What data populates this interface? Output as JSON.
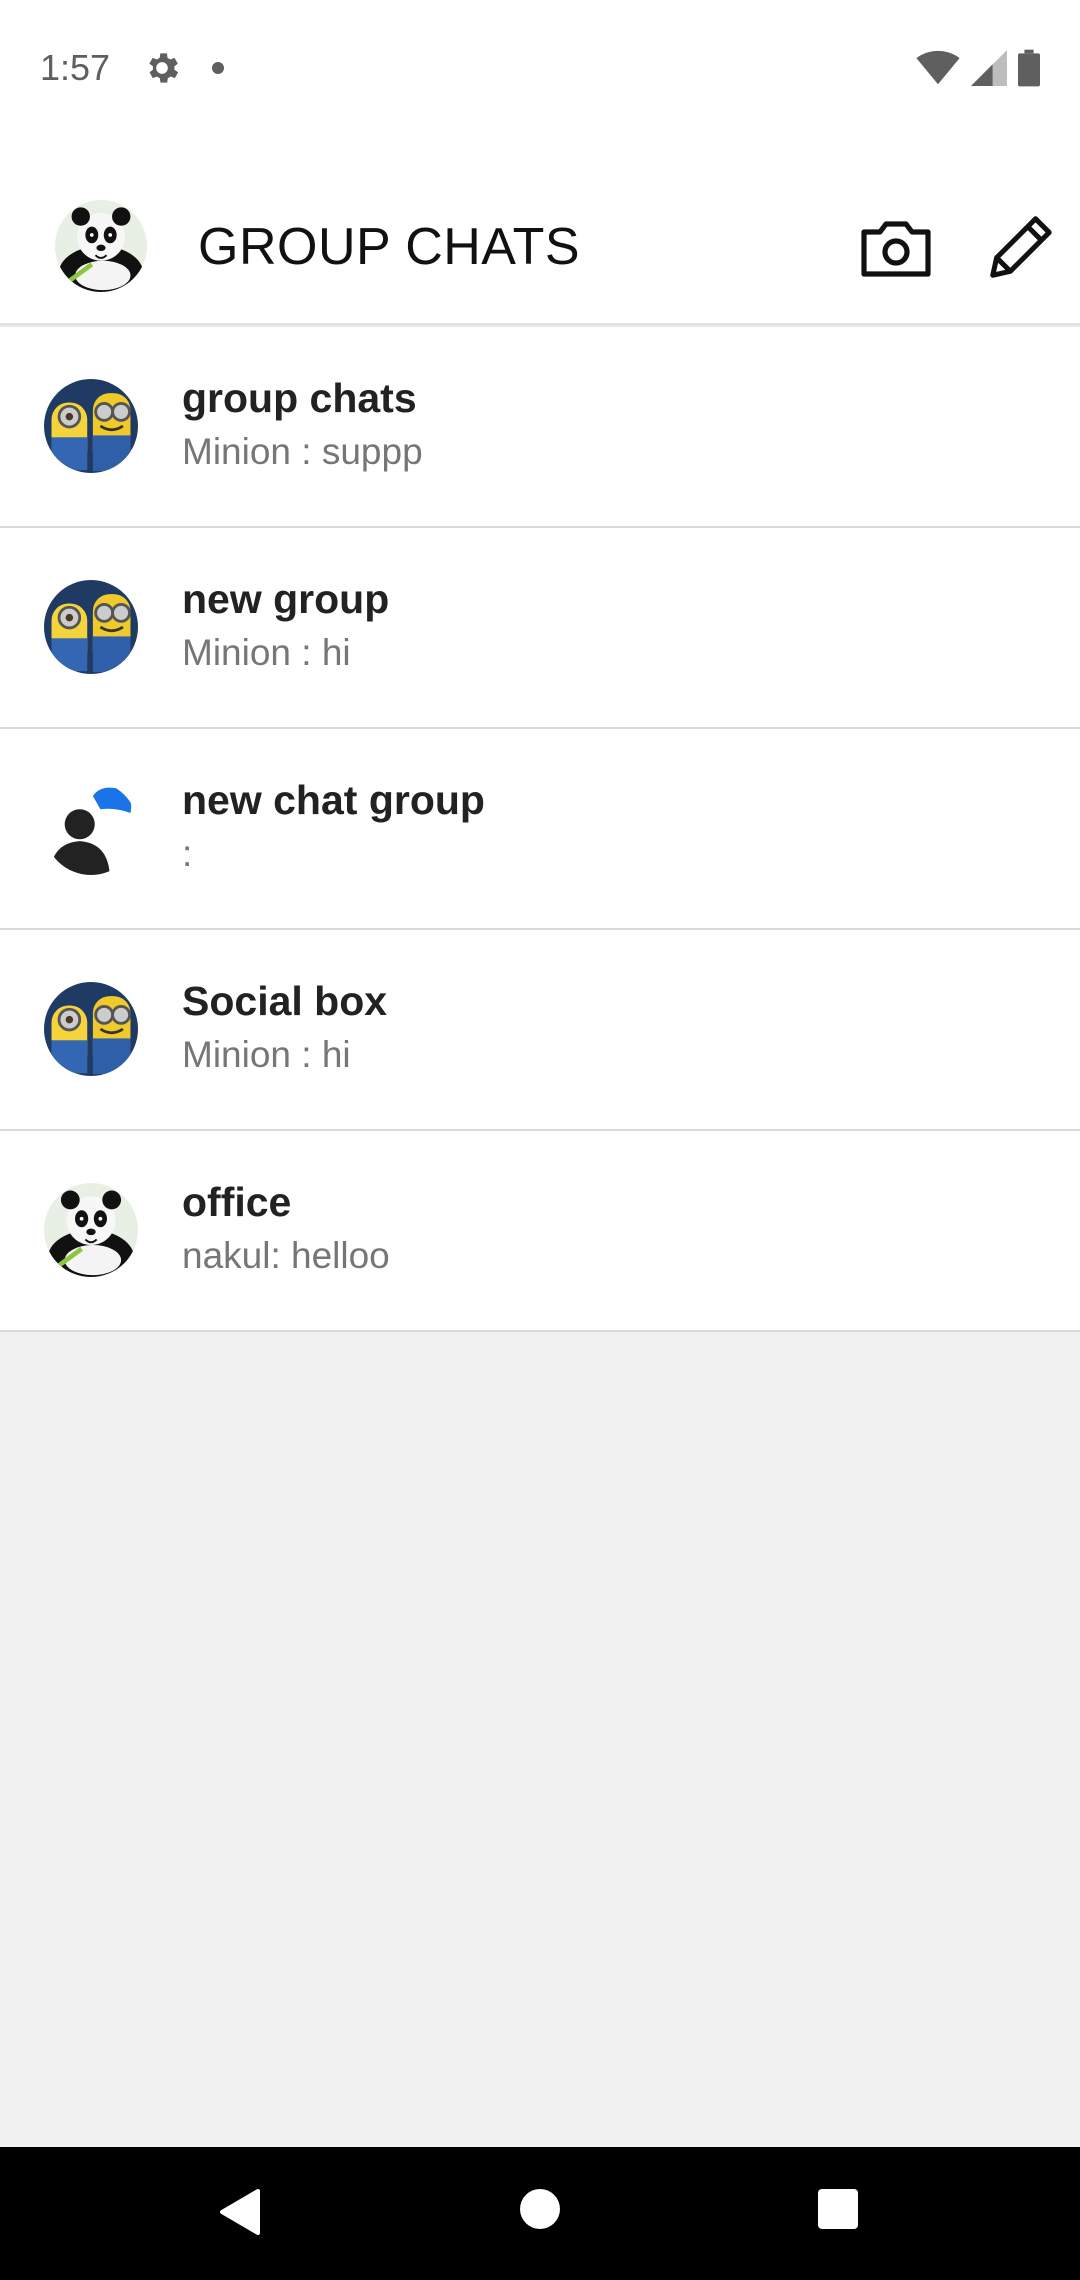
{
  "status_bar": {
    "time": "1:57",
    "icons": [
      "gear-icon",
      "dot-icon",
      "wifi-icon",
      "signal-icon",
      "battery-icon"
    ]
  },
  "appbar": {
    "title": "GROUP CHATS",
    "avatar": "panda-avatar",
    "actions": [
      "camera-icon",
      "edit-icon"
    ]
  },
  "chats": [
    {
      "title": "group chats",
      "preview": "Minion : suppp",
      "avatar": "minions-avatar"
    },
    {
      "title": "new group",
      "preview": "Minion : hi",
      "avatar": "minions-avatar"
    },
    {
      "title": "new chat group",
      "preview": ":",
      "avatar": "default-person-avatar"
    },
    {
      "title": "Social box",
      "preview": "Minion : hi",
      "avatar": "minions-avatar"
    },
    {
      "title": "office",
      "preview": "nakul: helloo",
      "avatar": "panda-avatar"
    }
  ],
  "nav_bar": {
    "buttons": [
      "back-icon",
      "home-icon",
      "recents-icon"
    ]
  },
  "colors": {
    "background": "#f1f1f1",
    "list_bg": "#ffffff",
    "divider": "#d9d9d9",
    "title_text": "#222222",
    "subtitle_text": "#767676",
    "bubble_blue": "#1a73e8"
  }
}
